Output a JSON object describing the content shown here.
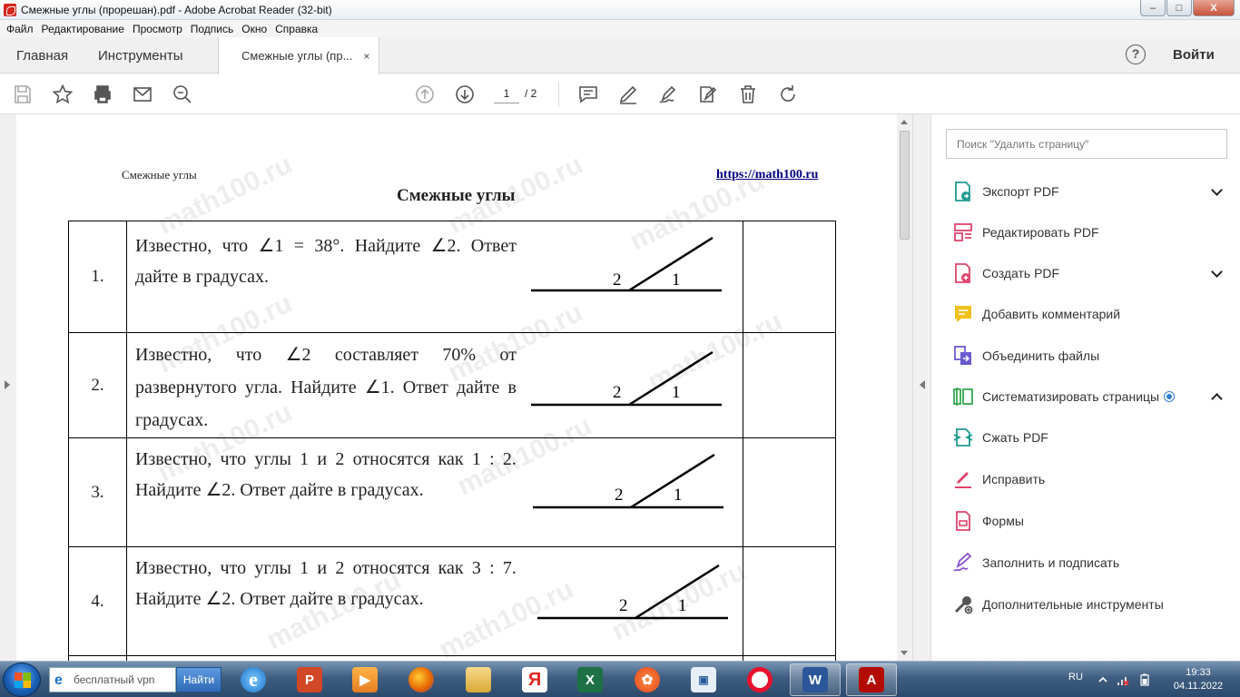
{
  "window": {
    "title": "Смежные углы (прорешан).pdf - Adobe Acrobat Reader (32-bit)",
    "controls": {
      "minimize": "–",
      "maximize": "□",
      "close": "X"
    }
  },
  "menu": [
    "Файл",
    "Редактирование",
    "Просмотр",
    "Подпись",
    "Окно",
    "Справка"
  ],
  "tabs": {
    "home": "Главная",
    "tools": "Инструменты",
    "document": "Смежные углы (пр...",
    "close_glyph": "×",
    "signin": "Войти",
    "help": "?"
  },
  "toolbar": {
    "current_page": "1",
    "total_pages": "/ 2"
  },
  "document": {
    "header_left": "Смежные углы",
    "header_right": "https://math100.ru",
    "title": "Смежные углы",
    "watermark": "math100.ru",
    "problems": [
      {
        "num": "1.",
        "text": "Известно, что ∠1 = 38°. Найдите ∠2. Ответ дайте в градусах.",
        "label_a": "2",
        "label_b": "1"
      },
      {
        "num": "2.",
        "text": "Известно, что ∠2 составляет 70% от развернутого угла. Найдите ∠1. Ответ дайте в градусах.",
        "label_a": "2",
        "label_b": "1"
      },
      {
        "num": "3.",
        "text": "Известно, что углы 1 и 2 относятся как 1 : 2. Найдите ∠2. Ответ дайте в градусах.",
        "label_a": "2",
        "label_b": "1"
      },
      {
        "num": "4.",
        "text": "Известно, что углы 1 и 2 относятся как 3 : 7. Найдите ∠2. Ответ дайте в градусах.",
        "label_a": "2",
        "label_b": "1"
      }
    ]
  },
  "panel": {
    "search_placeholder": "Поиск \"Удалить страницу\"",
    "tools": [
      {
        "label": "Экспорт PDF",
        "icon": "export-pdf-icon",
        "color": "#1f9b8f"
      },
      {
        "label": "Редактировать PDF",
        "icon": "edit-pdf-icon",
        "color": "#e0436b"
      },
      {
        "label": "Создать PDF",
        "icon": "create-pdf-icon",
        "color": "#e0436b"
      },
      {
        "label": "Добавить комментарий",
        "icon": "comment-icon",
        "color": "#f2c01b"
      },
      {
        "label": "Объединить файлы",
        "icon": "combine-files-icon",
        "color": "#6a5ccf"
      },
      {
        "label": "Систематизировать страницы",
        "icon": "organize-pages-icon",
        "color": "#35a852"
      },
      {
        "label": "Сжать PDF",
        "icon": "compress-pdf-icon",
        "color": "#1f9b8f"
      },
      {
        "label": "Исправить",
        "icon": "redact-icon",
        "color": "#e0436b"
      },
      {
        "label": "Формы",
        "icon": "forms-icon",
        "color": "#e0436b"
      },
      {
        "label": "Заполнить и подписать",
        "icon": "fill-sign-icon",
        "color": "#8a4fd1"
      },
      {
        "label": "Дополнительные инструменты",
        "icon": "more-tools-icon",
        "color": "#555555"
      }
    ]
  },
  "taskbar": {
    "search_text": "бесплатный vpn",
    "search_button": "Найти",
    "lang": "RU",
    "time": "19:33",
    "date": "04.11.2022"
  }
}
